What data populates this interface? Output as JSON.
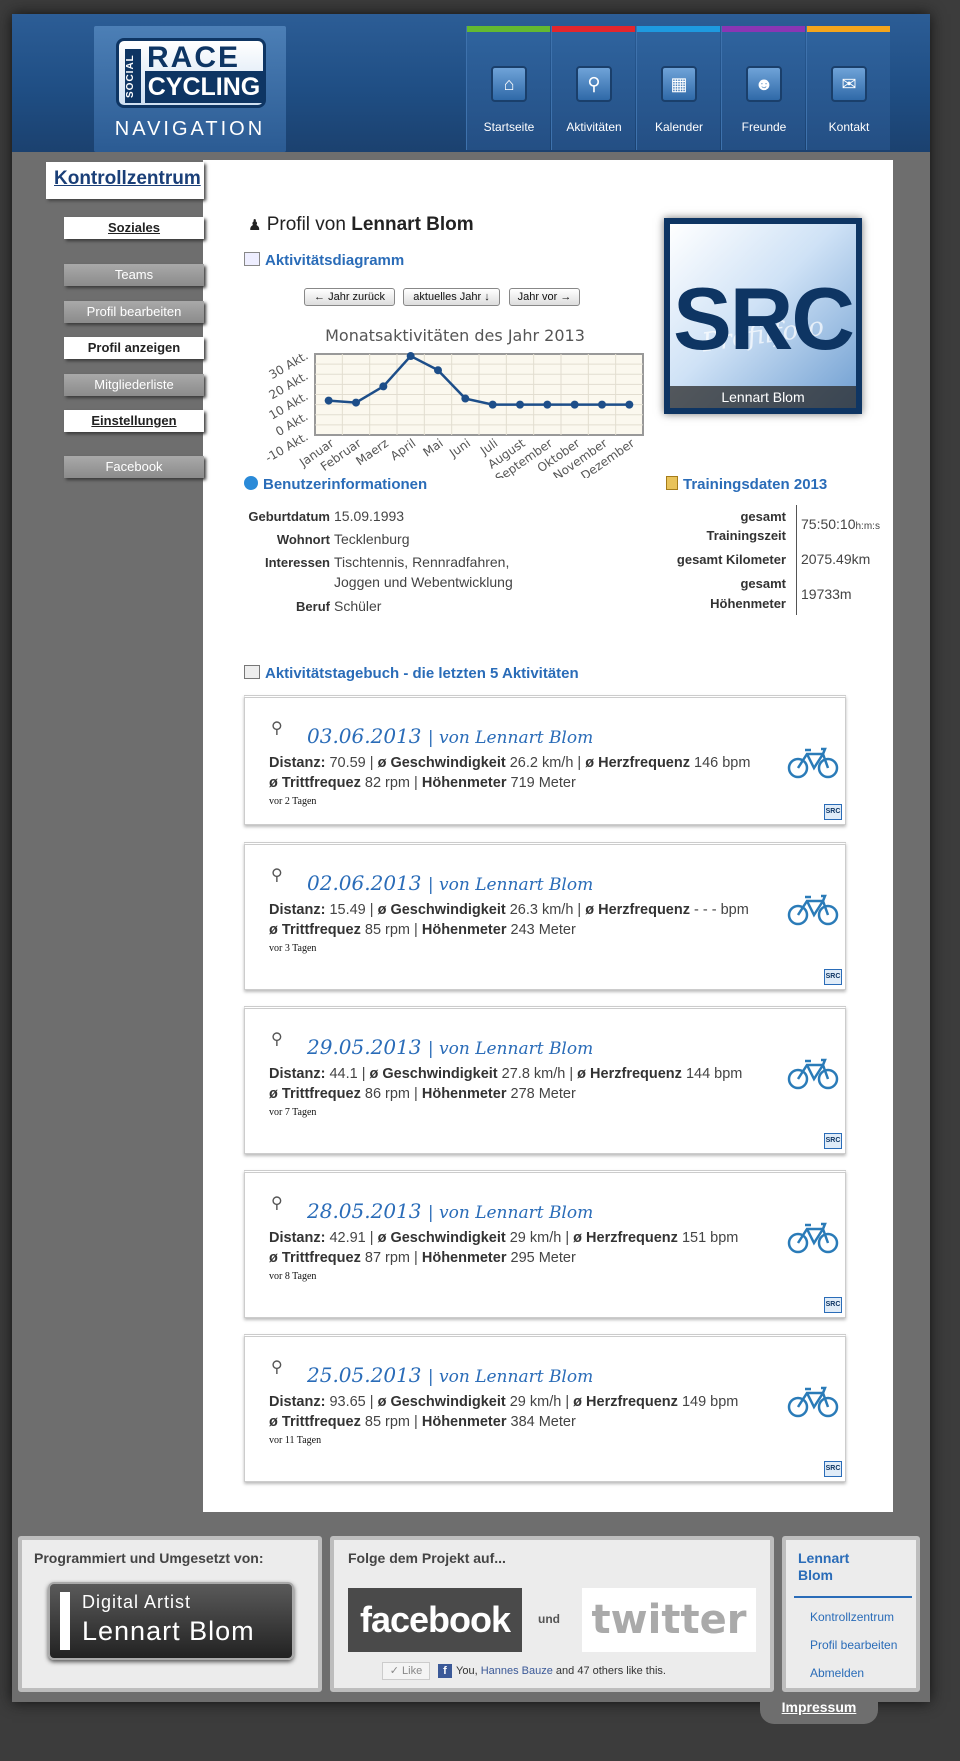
{
  "header": {
    "nav_title": "NAVIGATION",
    "logo_race": "RACE",
    "logo_cycling": "CYCLING",
    "logo_social": "SOCIAL",
    "nav": [
      {
        "label": "Startseite",
        "color": "#63b931",
        "icon": "house-icon"
      },
      {
        "label": "Aktivitäten",
        "color": "#e3262d",
        "icon": "bike-icon"
      },
      {
        "label": "Kalender",
        "color": "#1e9ae0",
        "icon": "calendar-icon"
      },
      {
        "label": "Freunde",
        "color": "#8a36b4",
        "icon": "friends-icon"
      },
      {
        "label": "Kontakt",
        "color": "#f4a51c",
        "icon": "envelope-icon"
      }
    ]
  },
  "sidebar": {
    "title": "Kontrollzentrum",
    "items": [
      "Soziales",
      "Teams",
      "Profil bearbeiten",
      "Profil anzeigen",
      "Mitgliederliste",
      "Einstellungen",
      "Facebook"
    ]
  },
  "profile": {
    "prefix": "Profil von",
    "name": "Lennart Blom",
    "photo_text": "SRC",
    "photo_watermark": "Profilfoto",
    "photo_name": "Lennart Blom"
  },
  "activity": {
    "heading": "Aktivitätsdiagramm",
    "btn_prev": "← Jahr zurück",
    "btn_current": "aktuelles Jahr ↓",
    "btn_next": "Jahr vor →"
  },
  "chart_data": {
    "type": "line",
    "title": "Monatsaktivitäten des Jahr 2013",
    "categories": [
      "Januar",
      "Februar",
      "Maerz",
      "April",
      "Mai",
      "Juni",
      "Juli",
      "August",
      "September",
      "Oktober",
      "November",
      "Dezember"
    ],
    "values": [
      7,
      6,
      14,
      29,
      22,
      8,
      5,
      5,
      5,
      5,
      5,
      5
    ],
    "ylim": [
      -10,
      30
    ],
    "yticks": [
      "-10 Akt.",
      "0 Akt.",
      "10 Akt.",
      "20 Akt.",
      "30 Akt."
    ],
    "grid": true,
    "color": "#1d4e89"
  },
  "userinfo": {
    "heading": "Benutzerinformationen",
    "rows": [
      {
        "label": "Geburtdatum",
        "value": "15.09.1993"
      },
      {
        "label": "Wohnort",
        "value": "Tecklenburg"
      },
      {
        "label": "Interessen",
        "value": "Tischtennis, Rennradfahren,",
        "value2": "Joggen und Webentwicklung"
      },
      {
        "label": "Beruf",
        "value": "Schüler"
      }
    ]
  },
  "training": {
    "heading": "Trainingsdaten 2013",
    "time_label1": "gesamt",
    "time_label2": "Trainingszeit",
    "time_value": "75:50:10",
    "time_unit": "h:m:s",
    "km_label": "gesamt Kilometer",
    "km_value": "2075.49km",
    "hm_label1": "gesamt",
    "hm_label2": "Höhenmeter",
    "hm_value": "19733m"
  },
  "diary": {
    "heading": "Aktivitätstagebuch - die letzten 5 Aktivitäten",
    "labels": {
      "dist": "Distanz:",
      "speed": "ø Geschwindigkeit",
      "hf": "ø Herzfrequenz",
      "cad": "ø Trittfrequez",
      "hm": "Höhenmeter",
      "sep": "|",
      "src": "SRC"
    },
    "entries": [
      {
        "date": "03.06.2013",
        "by": "| von Lennart Blom",
        "dist": "70.59",
        "speed": "26.2 km/h",
        "hf": "146 bpm",
        "cad": "82 rpm",
        "hm": "719 Meter",
        "ago": "vor 2 Tagen"
      },
      {
        "date": "02.06.2013",
        "by": "| von Lennart Blom",
        "dist": "15.49",
        "speed": "26.3 km/h",
        "hf": "- - - bpm",
        "cad": "85 rpm",
        "hm": "243 Meter",
        "ago": "vor 3 Tagen"
      },
      {
        "date": "29.05.2013",
        "by": "| von Lennart Blom",
        "dist": "44.1",
        "speed": "27.8 km/h",
        "hf": "144 bpm",
        "cad": "86 rpm",
        "hm": "278 Meter",
        "ago": "vor 7 Tagen"
      },
      {
        "date": "28.05.2013",
        "by": "| von Lennart Blom",
        "dist": "42.91",
        "speed": "29 km/h",
        "hf": "151 bpm",
        "cad": "87 rpm",
        "hm": "295 Meter",
        "ago": "vor 8 Tagen"
      },
      {
        "date": "25.05.2013",
        "by": "| von Lennart Blom",
        "dist": "93.65",
        "speed": "29 km/h",
        "hf": "149 bpm",
        "cad": "85 rpm",
        "hm": "384 Meter",
        "ago": "vor 11 Tagen"
      }
    ]
  },
  "footer": {
    "left_title": "Programmiert und Umgesetzt von:",
    "da_line1": "Digital Artist",
    "da_line2": "Lennart Blom",
    "mid_title": "Folge dem Projekt auf...",
    "facebook": "facebook",
    "und": "und",
    "twitter": "twitter",
    "like_btn": "✓ Like",
    "like_you": "You, ",
    "like_name": "Hannes Bauze",
    "like_rest": " and 47 others like this.",
    "user_title1": "Lennart",
    "user_title2": "Blom",
    "links": [
      "Kontrollzentrum",
      "Profil bearbeiten",
      "Abmelden"
    ],
    "impressum": "Impressum"
  }
}
